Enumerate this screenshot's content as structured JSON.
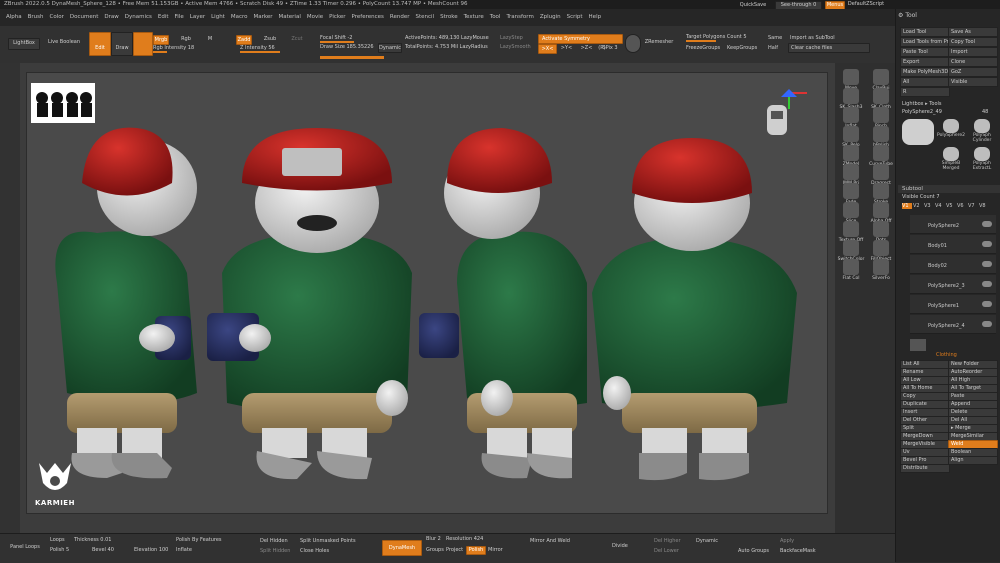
{
  "titlebar": {
    "text": "ZBrush 2022.0.5   DynaMesh_Sphere_128   • Free Mem 51.153GB • Active Mem 4766 • Scratch Disk 49 • ZTime 1.33 Timer 0.296 • PolyCount 13.747 MP • MeshCount 96"
  },
  "menu": [
    "Alpha",
    "Brush",
    "Color",
    "Document",
    "Draw",
    "Dynamics",
    "Edit",
    "File",
    "Layer",
    "Light",
    "Macro",
    "Marker",
    "Material",
    "Movie",
    "Picker",
    "Preferences",
    "Render",
    "Stencil",
    "Stroke",
    "Texture",
    "Tool",
    "Transform",
    "Zplugin",
    "Script",
    "Help"
  ],
  "topright": {
    "quicksave": "QuickSave",
    "seethrough": "See-through  0",
    "menus": "Menus",
    "script": "DefaultZScript"
  },
  "toolbar": {
    "lightbox": "LightBox",
    "liveboolean": "Live Boolean",
    "edit": "Edit",
    "draw": "Draw",
    "mrgb": "Mrgb",
    "rgb": "Rgb",
    "m": "M",
    "rgb_intensity": "Rgb Intensity 18",
    "zadd": "Zadd",
    "zsub": "Zsub",
    "zcut": "Zcut",
    "z_intensity": "Z Intensity 56",
    "focal_shift": "Focal Shift -2",
    "draw_size": "Draw Size 185.35226",
    "dynamic": "Dynamic",
    "active_points": "ActivePoints: 489,130 LazyMouse",
    "total_points": "TotalPoints: 4.753 Mil LazyRadius",
    "lazystep": "LazyStep",
    "lazysmooth": "LazySmooth",
    "activate_symmetry": "Activate Symmetry",
    "sym_x": ">X<",
    "sym_y": ">Y<",
    "sym_z": ">Z<",
    "sym_r": "(R)",
    "spix": "SPix 3",
    "zremesher": "ZRemesher",
    "target_polys": "Target Polygons Count 5",
    "freeze_groups": "FreezeGroups",
    "keep_groups": "KeepGroups",
    "same": "Same",
    "half": "Half",
    "import_subtool": "Import as SubTool",
    "clear_cache": "Clear cache files"
  },
  "shelf": [
    "Move",
    "ClayBui",
    "SK_Slash3",
    "SK_Cloth",
    "Inflat",
    "Pinch",
    "SK_Pelo",
    "hPolish",
    "ZModel",
    "CurveTube",
    "IMM Pri",
    "Dragrect",
    "Fade",
    "Stroke",
    "Slice",
    "Alpha Off",
    "Texture Off",
    "Dots",
    "SwitchColor",
    "FillObject",
    "Flat Col",
    "SilverFo"
  ],
  "tray": {
    "title": "Tool",
    "buttons": [
      "Load Tool",
      "Save As",
      "Load Tools from Project",
      "Copy Tool",
      "Paste Tool",
      "Import",
      "Export",
      "Clone",
      "Make PolyMesh3D",
      "GoZ",
      "All",
      "Visible",
      "R"
    ],
    "lightbox_tools": "Lightbox ▸ Tools",
    "current_tool": "PolySphere2_49",
    "current_tool_value": "48",
    "thumbs": [
      "PolySphere2",
      "PolySph Cylinder",
      "SimpleB Merged",
      "PolySph ExtractL"
    ],
    "subtool_header": "Subtool",
    "visible_count": "Visible Count 7",
    "v_tabs": [
      "V1",
      "V2",
      "V3",
      "V4",
      "V5",
      "V6",
      "V7",
      "V8"
    ],
    "subtools": [
      "PolySphere2",
      "Body01",
      "Body02",
      "PolySphere2_3",
      "PolySphere1",
      "PolySphere2_4"
    ],
    "clothing": "Clothing",
    "list": [
      "List All",
      "New Folder",
      "Rename",
      "AutoReorder",
      "All Low",
      "All High",
      "All To Home",
      "All To Target",
      "Copy",
      "Paste",
      "Duplicate",
      "Append",
      "Insert",
      "Delete",
      "Del Other",
      "Del All",
      "Split",
      "▸ Merge",
      "MergeDown",
      "MergeSimilar",
      "MergeVisible",
      "Weld",
      "Uv",
      "Boolean",
      "Bevel Pro",
      "Align",
      "Distribute"
    ]
  },
  "bottombar": {
    "panel_loops": "Panel Loops",
    "loops": "Loops",
    "thickness": "Thickness 0.01",
    "polish": "Polish 5",
    "bevel": "Bevel 40",
    "elevation": "Elevation 100",
    "polish_features": "Polish By Features",
    "inflate": "Inflate",
    "del_hidden": "Del Hidden",
    "split_hidden": "Split Hidden",
    "split_unmasked": "Split Unmasked Points",
    "close_holes": "Close Holes",
    "dynamesh": "DynaMesh",
    "groups": "Groups",
    "project": "Project",
    "blur": "Blur 2",
    "resolution": "Resolution 424",
    "polish_btn": "Polish",
    "mirror": "Mirror",
    "mirror_weld": "Mirror And Weld",
    "divide": "Divide",
    "del_higher": "Del Higher",
    "del_lower": "Del Lower",
    "dynamic": "Dynamic",
    "apply": "Apply",
    "auto_groups": "Auto Groups",
    "backface_mask": "BackfaceMask"
  },
  "logo": {
    "text": "KARMIEH"
  },
  "colors": {
    "accent": "#e07d1c",
    "hoodie": "#1f5a35",
    "beanie": "#b51d1c",
    "mug": "#2a3260",
    "pants": "#a58d62"
  }
}
